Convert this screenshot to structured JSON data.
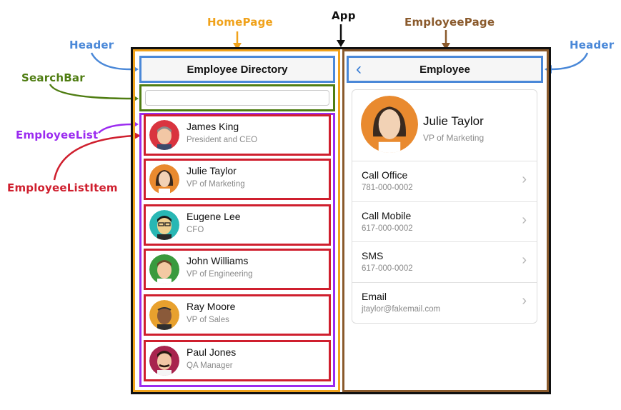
{
  "annotations": {
    "app": "App",
    "home_page": "HomePage",
    "employee_page": "EmployeePage",
    "header_left": "Header",
    "header_right": "Header",
    "search_bar": "SearchBar",
    "employee_list": "EmployeeList",
    "employee_list_item": "EmployeeListItem"
  },
  "home": {
    "header_title": "Employee Directory",
    "search_value": "",
    "employees": [
      {
        "name": "James King",
        "title": "President and CEO"
      },
      {
        "name": "Julie Taylor",
        "title": "VP of Marketing"
      },
      {
        "name": "Eugene Lee",
        "title": "CFO"
      },
      {
        "name": "John Williams",
        "title": "VP of Engineering"
      },
      {
        "name": "Ray Moore",
        "title": "VP of Sales"
      },
      {
        "name": "Paul Jones",
        "title": "QA Manager"
      }
    ]
  },
  "employee": {
    "header_title": "Employee",
    "name": "Julie Taylor",
    "title": "VP of Marketing",
    "actions": [
      {
        "label": "Call Office",
        "value": "781-000-0002"
      },
      {
        "label": "Call Mobile",
        "value": "617-000-0002"
      },
      {
        "label": "SMS",
        "value": "617-000-0002"
      },
      {
        "label": "Email",
        "value": "jtaylor@fakemail.com"
      }
    ]
  },
  "colors": {
    "app": "#111111",
    "home_page": "#f0a21b",
    "employee_page": "#8a5a2c",
    "header": "#4a88d8",
    "search_bar": "#4f7d12",
    "employee_list": "#9b2bf0",
    "employee_list_item": "#cf1f2e"
  },
  "icons": {
    "back": "chevron-left-icon",
    "row": "chevron-right-icon"
  }
}
